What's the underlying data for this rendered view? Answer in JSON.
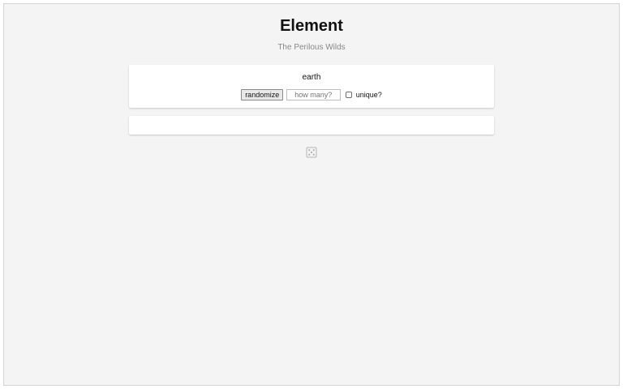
{
  "page": {
    "title": "Element",
    "subtitle": "The Perilous Wilds"
  },
  "result": {
    "value": "earth"
  },
  "controls": {
    "randomize_label": "randomize",
    "how_many_placeholder": "how many?",
    "how_many_value": "",
    "unique_label": "unique?",
    "unique_checked": false
  },
  "second_panel": {
    "text": ""
  },
  "icons": {
    "dice": "dice-icon"
  },
  "colors": {
    "background": "#f4f4f4",
    "card": "#ffffff",
    "subtitle": "#888888"
  }
}
